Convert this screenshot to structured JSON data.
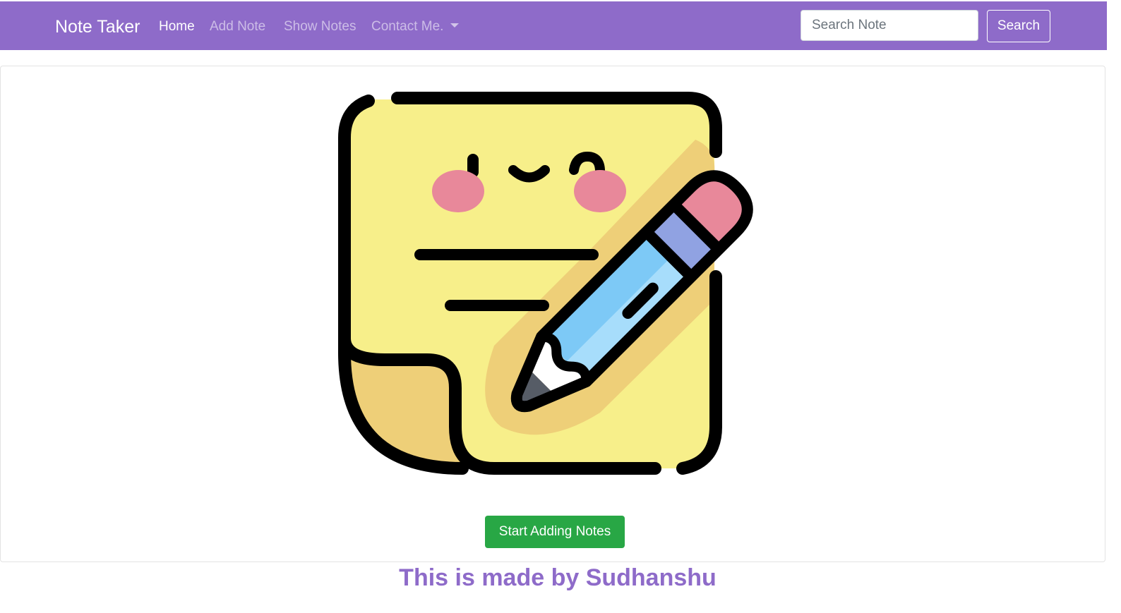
{
  "navbar": {
    "brand": "Note Taker",
    "links": [
      {
        "label": "Home",
        "active": true
      },
      {
        "label": "Add Note",
        "active": false
      },
      {
        "label": "Show Notes",
        "active": false
      },
      {
        "label": "Contact Me.",
        "active": false,
        "dropdown": true
      }
    ],
    "search": {
      "placeholder": "Search Note",
      "value": "",
      "button_label": "Search"
    },
    "background_color": "#8e6bc9"
  },
  "main": {
    "illustration": "sticky-note-with-pencil-icon",
    "start_button_label": "Start Adding Notes",
    "start_button_color": "#28a745"
  },
  "footer": {
    "text": "This is made by Sudhanshu",
    "color": "#8e6bc9"
  }
}
